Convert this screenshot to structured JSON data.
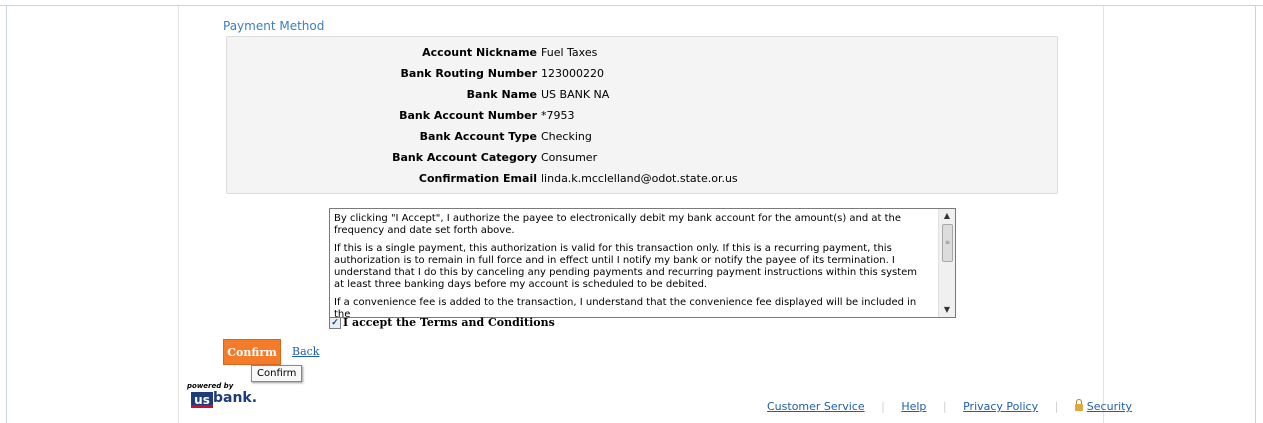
{
  "payment_method": {
    "title": "Payment Method",
    "fields": [
      {
        "label": "Account Nickname",
        "value": "Fuel Taxes"
      },
      {
        "label": "Bank Routing Number",
        "value": "123000220"
      },
      {
        "label": "Bank Name",
        "value": "US BANK NA"
      },
      {
        "label": "Bank Account Number",
        "value": "*7953"
      },
      {
        "label": "Bank Account Type",
        "value": "Checking"
      },
      {
        "label": "Bank Account Category",
        "value": "Consumer"
      },
      {
        "label": "Confirmation Email",
        "value": "linda.k.mcclelland@odot.state.or.us"
      }
    ]
  },
  "terms": {
    "paragraphs": [
      "By clicking \"I Accept\", I authorize the payee to electronically debit my bank account for the amount(s) and at the frequency and date set forth above.",
      "If this is a single payment, this authorization is valid for this transaction only. If this is a recurring payment, this authorization is to remain in full force and in effect until I notify my bank or notify the payee of its termination. I understand that I do this by canceling any pending payments and recurring payment instructions within this system at least three banking days before my account is scheduled to be debited.",
      "If a convenience fee is added to the transaction, I understand that the convenience fee displayed will be included in the"
    ],
    "accept_label": "I accept the Terms and Conditions",
    "accept_checked": "✓"
  },
  "actions": {
    "confirm_label": "Confirm",
    "back_label": "Back",
    "tooltip": "Confirm"
  },
  "logo": {
    "powered_by": "powered by",
    "mark": "us",
    "word": "bank."
  },
  "footer": {
    "links": [
      "Customer Service",
      "Help",
      "Privacy Policy",
      "Security"
    ]
  },
  "colors": {
    "accent": "#3a7ec1",
    "button": "#f47b2a",
    "link": "#1f5fa8"
  }
}
